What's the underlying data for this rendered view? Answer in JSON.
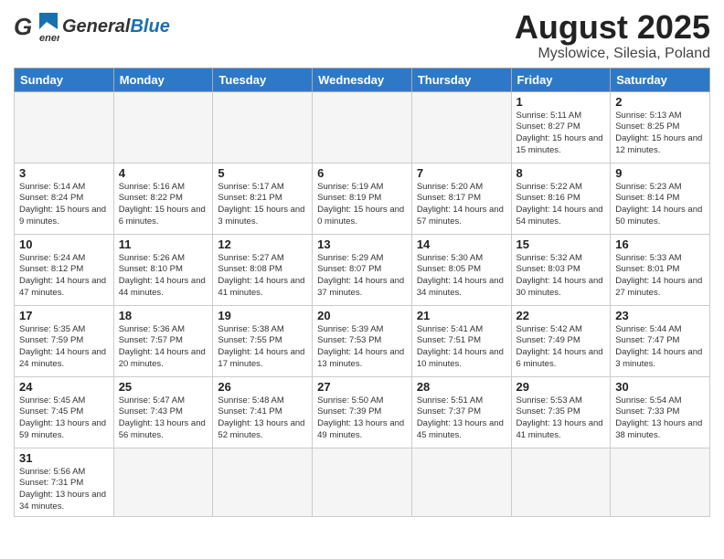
{
  "header": {
    "logo_general": "General",
    "logo_blue": "Blue",
    "month_title": "August 2025",
    "location": "Myslowice, Silesia, Poland"
  },
  "weekdays": [
    "Sunday",
    "Monday",
    "Tuesday",
    "Wednesday",
    "Thursday",
    "Friday",
    "Saturday"
  ],
  "days": [
    {
      "date": "",
      "info": ""
    },
    {
      "date": "",
      "info": ""
    },
    {
      "date": "",
      "info": ""
    },
    {
      "date": "",
      "info": ""
    },
    {
      "date": "",
      "info": ""
    },
    {
      "date": "1",
      "info": "Sunrise: 5:11 AM\nSunset: 8:27 PM\nDaylight: 15 hours\nand 15 minutes."
    },
    {
      "date": "2",
      "info": "Sunrise: 5:13 AM\nSunset: 8:25 PM\nDaylight: 15 hours\nand 12 minutes."
    },
    {
      "date": "3",
      "info": "Sunrise: 5:14 AM\nSunset: 8:24 PM\nDaylight: 15 hours\nand 9 minutes."
    },
    {
      "date": "4",
      "info": "Sunrise: 5:16 AM\nSunset: 8:22 PM\nDaylight: 15 hours\nand 6 minutes."
    },
    {
      "date": "5",
      "info": "Sunrise: 5:17 AM\nSunset: 8:21 PM\nDaylight: 15 hours\nand 3 minutes."
    },
    {
      "date": "6",
      "info": "Sunrise: 5:19 AM\nSunset: 8:19 PM\nDaylight: 15 hours\nand 0 minutes."
    },
    {
      "date": "7",
      "info": "Sunrise: 5:20 AM\nSunset: 8:17 PM\nDaylight: 14 hours\nand 57 minutes."
    },
    {
      "date": "8",
      "info": "Sunrise: 5:22 AM\nSunset: 8:16 PM\nDaylight: 14 hours\nand 54 minutes."
    },
    {
      "date": "9",
      "info": "Sunrise: 5:23 AM\nSunset: 8:14 PM\nDaylight: 14 hours\nand 50 minutes."
    },
    {
      "date": "10",
      "info": "Sunrise: 5:24 AM\nSunset: 8:12 PM\nDaylight: 14 hours\nand 47 minutes."
    },
    {
      "date": "11",
      "info": "Sunrise: 5:26 AM\nSunset: 8:10 PM\nDaylight: 14 hours\nand 44 minutes."
    },
    {
      "date": "12",
      "info": "Sunrise: 5:27 AM\nSunset: 8:08 PM\nDaylight: 14 hours\nand 41 minutes."
    },
    {
      "date": "13",
      "info": "Sunrise: 5:29 AM\nSunset: 8:07 PM\nDaylight: 14 hours\nand 37 minutes."
    },
    {
      "date": "14",
      "info": "Sunrise: 5:30 AM\nSunset: 8:05 PM\nDaylight: 14 hours\nand 34 minutes."
    },
    {
      "date": "15",
      "info": "Sunrise: 5:32 AM\nSunset: 8:03 PM\nDaylight: 14 hours\nand 30 minutes."
    },
    {
      "date": "16",
      "info": "Sunrise: 5:33 AM\nSunset: 8:01 PM\nDaylight: 14 hours\nand 27 minutes."
    },
    {
      "date": "17",
      "info": "Sunrise: 5:35 AM\nSunset: 7:59 PM\nDaylight: 14 hours\nand 24 minutes."
    },
    {
      "date": "18",
      "info": "Sunrise: 5:36 AM\nSunset: 7:57 PM\nDaylight: 14 hours\nand 20 minutes."
    },
    {
      "date": "19",
      "info": "Sunrise: 5:38 AM\nSunset: 7:55 PM\nDaylight: 14 hours\nand 17 minutes."
    },
    {
      "date": "20",
      "info": "Sunrise: 5:39 AM\nSunset: 7:53 PM\nDaylight: 14 hours\nand 13 minutes."
    },
    {
      "date": "21",
      "info": "Sunrise: 5:41 AM\nSunset: 7:51 PM\nDaylight: 14 hours\nand 10 minutes."
    },
    {
      "date": "22",
      "info": "Sunrise: 5:42 AM\nSunset: 7:49 PM\nDaylight: 14 hours\nand 6 minutes."
    },
    {
      "date": "23",
      "info": "Sunrise: 5:44 AM\nSunset: 7:47 PM\nDaylight: 14 hours\nand 3 minutes."
    },
    {
      "date": "24",
      "info": "Sunrise: 5:45 AM\nSunset: 7:45 PM\nDaylight: 13 hours\nand 59 minutes."
    },
    {
      "date": "25",
      "info": "Sunrise: 5:47 AM\nSunset: 7:43 PM\nDaylight: 13 hours\nand 56 minutes."
    },
    {
      "date": "26",
      "info": "Sunrise: 5:48 AM\nSunset: 7:41 PM\nDaylight: 13 hours\nand 52 minutes."
    },
    {
      "date": "27",
      "info": "Sunrise: 5:50 AM\nSunset: 7:39 PM\nDaylight: 13 hours\nand 49 minutes."
    },
    {
      "date": "28",
      "info": "Sunrise: 5:51 AM\nSunset: 7:37 PM\nDaylight: 13 hours\nand 45 minutes."
    },
    {
      "date": "29",
      "info": "Sunrise: 5:53 AM\nSunset: 7:35 PM\nDaylight: 13 hours\nand 41 minutes."
    },
    {
      "date": "30",
      "info": "Sunrise: 5:54 AM\nSunset: 7:33 PM\nDaylight: 13 hours\nand 38 minutes."
    },
    {
      "date": "31",
      "info": "Sunrise: 5:56 AM\nSunset: 7:31 PM\nDaylight: 13 hours\nand 34 minutes."
    }
  ]
}
